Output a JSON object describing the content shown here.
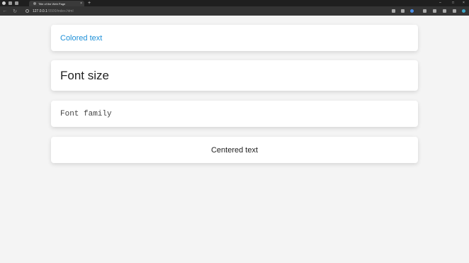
{
  "browser": {
    "tab_title": "Title of the Web Page",
    "tab_close": "×",
    "new_tab": "+",
    "url_host": "127.0.0.1",
    "url_path": ":5500/index.html",
    "window_controls": [
      "–",
      "□",
      "×"
    ]
  },
  "cards": [
    {
      "text": "Colored text",
      "color": "#1e90d8"
    },
    {
      "text": "Font size"
    },
    {
      "text": "Font family"
    },
    {
      "text": "Centered text"
    }
  ]
}
